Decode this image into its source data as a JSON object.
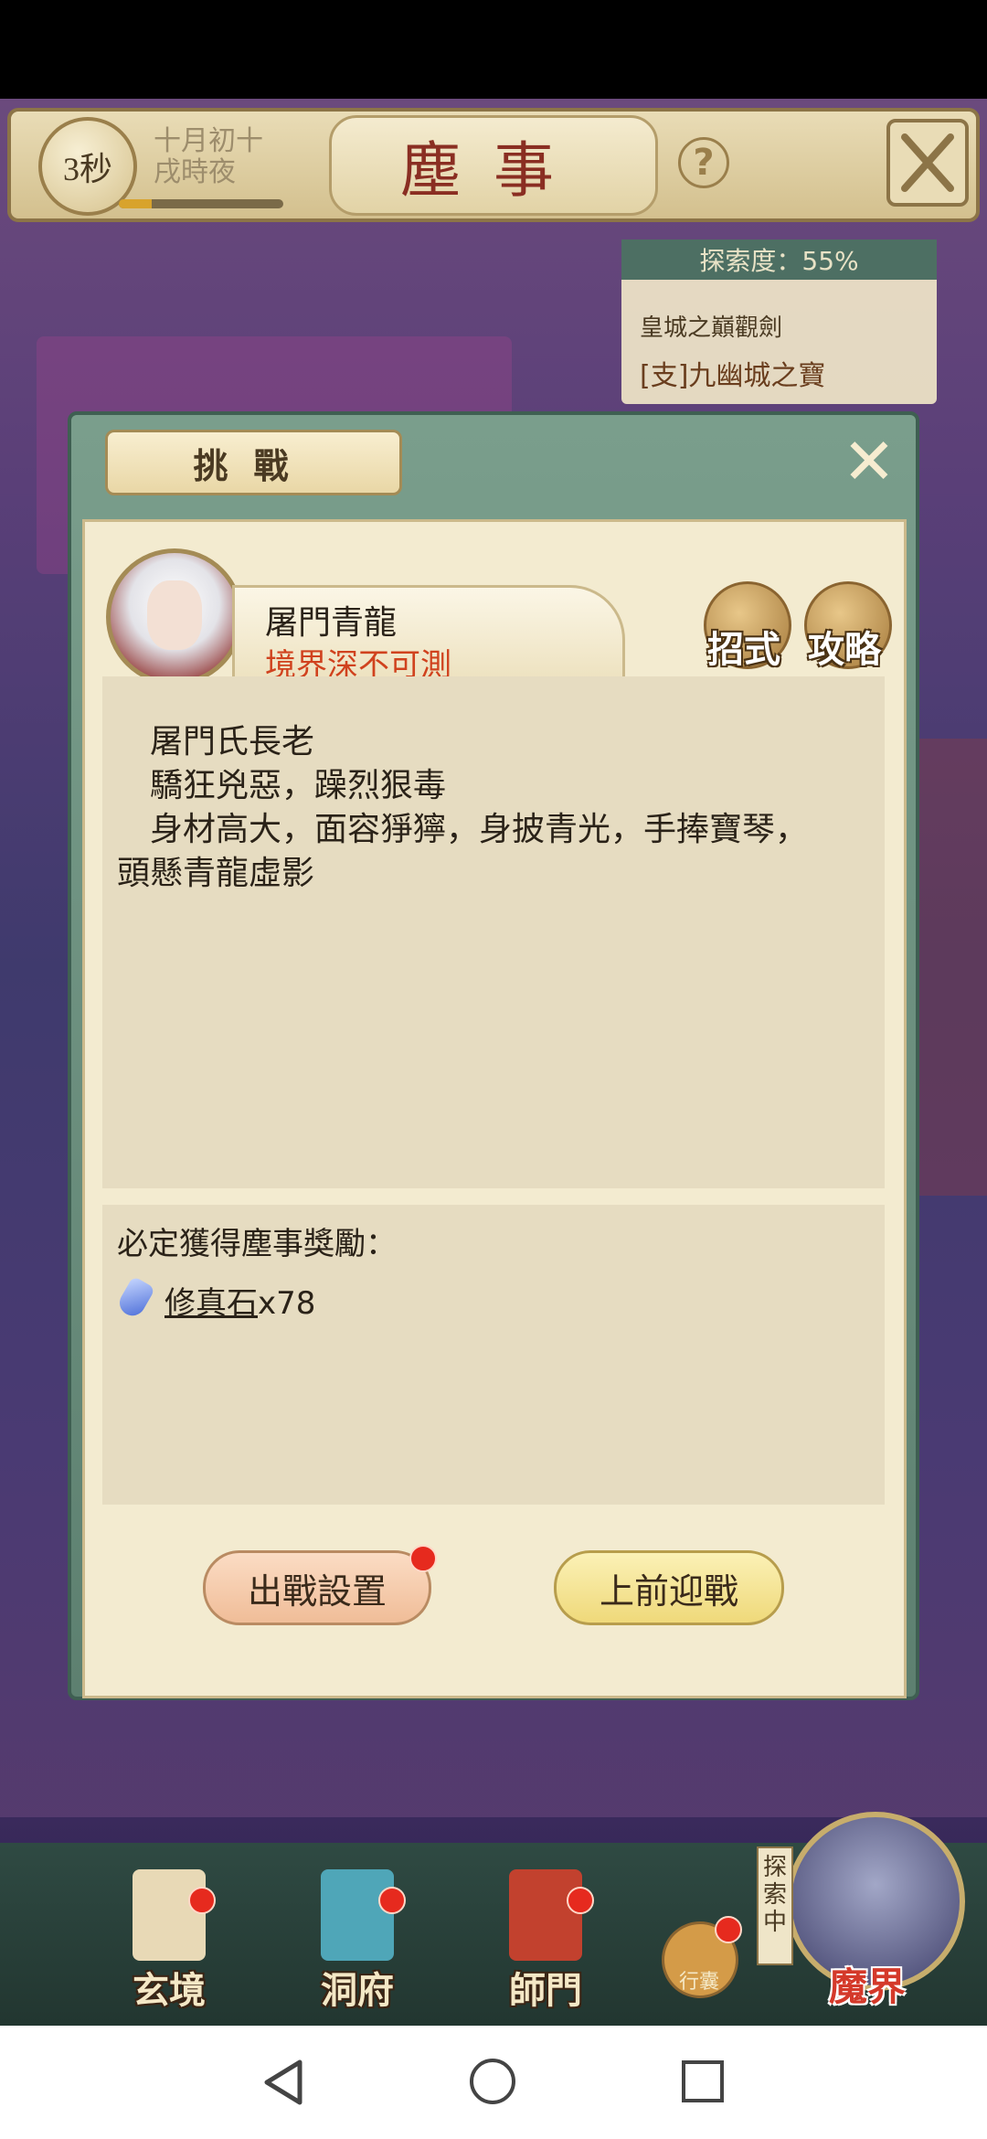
{
  "header": {
    "timer": "3秒",
    "date_line1": "十月初十",
    "date_line2": "戌時夜",
    "title": "塵事",
    "help_icon": "question-icon",
    "close_icon": "close-icon"
  },
  "explore": {
    "progress_label": "探索度：55%",
    "line1": "皇城之巔觀劍",
    "line2": "[支]九幽城之寶"
  },
  "modal": {
    "title": "挑戰",
    "boss": {
      "name": "屠門青龍",
      "realm": "境界深不可測"
    },
    "side_buttons": {
      "moves": "招式",
      "guide": "攻略"
    },
    "description": [
      "屠門氏長老",
      "驕狂兇惡，躁烈狠毒",
      "身材高大，面容猙獰，身披青光，手捧寶琴，",
      "頭懸青龍虛影"
    ],
    "reward": {
      "label": "必定獲得塵事獎勵：",
      "item_name": "修真石",
      "item_qty": "x78",
      "item_icon": "crystal-icon"
    },
    "buttons": {
      "setup": "出戰設置",
      "fight": "上前迎戰"
    }
  },
  "bottom_nav": {
    "items": [
      {
        "label": "玄境"
      },
      {
        "label": "洞府"
      },
      {
        "label": "師門"
      }
    ],
    "bag": "行囊",
    "explore_tag": "探索中",
    "demon": "魔界"
  },
  "colors": {
    "accent_red": "#d0421e",
    "panel_green": "#5d8070",
    "parchment": "#f3ebd0"
  }
}
